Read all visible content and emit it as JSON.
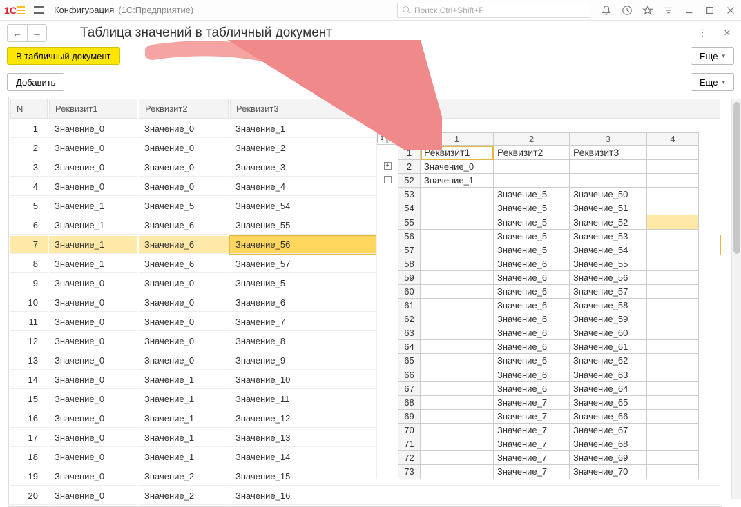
{
  "titlebar": {
    "app": "Конфигурация",
    "sub": "(1С:Предприятие)",
    "search_placeholder": "Поиск Ctrl+Shift+F"
  },
  "page": {
    "title": "Таблица значений в табличный документ",
    "btn_to_doc": "В табличный документ",
    "btn_more": "Еще",
    "btn_add": "Добавить"
  },
  "left": {
    "headers": {
      "n": "N",
      "r1": "Реквизит1",
      "r2": "Реквизит2",
      "r3": "Реквизит3"
    },
    "rows": [
      {
        "n": 1,
        "r1": "Значение_0",
        "r2": "Значение_0",
        "r3": "Значение_1"
      },
      {
        "n": 2,
        "r1": "Значение_0",
        "r2": "Значение_0",
        "r3": "Значение_2"
      },
      {
        "n": 3,
        "r1": "Значение_0",
        "r2": "Значение_0",
        "r3": "Значение_3"
      },
      {
        "n": 4,
        "r1": "Значение_0",
        "r2": "Значение_0",
        "r3": "Значение_4"
      },
      {
        "n": 5,
        "r1": "Значение_1",
        "r2": "Значение_5",
        "r3": "Значение_54"
      },
      {
        "n": 6,
        "r1": "Значение_1",
        "r2": "Значение_6",
        "r3": "Значение_55"
      },
      {
        "n": 7,
        "r1": "Значение_1",
        "r2": "Значение_6",
        "r3": "Значение_56",
        "sel": true
      },
      {
        "n": 8,
        "r1": "Значение_1",
        "r2": "Значение_6",
        "r3": "Значение_57"
      },
      {
        "n": 9,
        "r1": "Значение_0",
        "r2": "Значение_0",
        "r3": "Значение_5"
      },
      {
        "n": 10,
        "r1": "Значение_0",
        "r2": "Значение_0",
        "r3": "Значение_6"
      },
      {
        "n": 11,
        "r1": "Значение_0",
        "r2": "Значение_0",
        "r3": "Значение_7"
      },
      {
        "n": 12,
        "r1": "Значение_0",
        "r2": "Значение_0",
        "r3": "Значение_8"
      },
      {
        "n": 13,
        "r1": "Значение_0",
        "r2": "Значение_0",
        "r3": "Значение_9"
      },
      {
        "n": 14,
        "r1": "Значение_0",
        "r2": "Значение_1",
        "r3": "Значение_10"
      },
      {
        "n": 15,
        "r1": "Значение_0",
        "r2": "Значение_1",
        "r3": "Значение_11"
      },
      {
        "n": 16,
        "r1": "Значение_0",
        "r2": "Значение_1",
        "r3": "Значение_12"
      },
      {
        "n": 17,
        "r1": "Значение_0",
        "r2": "Значение_1",
        "r3": "Значение_13"
      },
      {
        "n": 18,
        "r1": "Значение_0",
        "r2": "Значение_1",
        "r3": "Значение_14"
      },
      {
        "n": 19,
        "r1": "Значение_0",
        "r2": "Значение_2",
        "r3": "Значение_15"
      },
      {
        "n": 20,
        "r1": "Значение_0",
        "r2": "Значение_2",
        "r3": "Значение_16"
      }
    ]
  },
  "sheet": {
    "col_headers": [
      "1",
      "2",
      "3",
      "4"
    ],
    "header_row": {
      "rh": "1",
      "c1": "Реквизит1",
      "c2": "Реквизит2",
      "c3": "Реквизит3"
    },
    "rows": [
      {
        "rh": "2",
        "c1": "Значение_0",
        "c2": "",
        "c3": ""
      },
      {
        "rh": "52",
        "c1": "Значение_1",
        "c2": "",
        "c3": ""
      },
      {
        "rh": "53",
        "c1": "",
        "c2": "Значение_5",
        "c3": "Значение_50"
      },
      {
        "rh": "54",
        "c1": "",
        "c2": "Значение_5",
        "c3": "Значение_51"
      },
      {
        "rh": "55",
        "c1": "",
        "c2": "Значение_5",
        "c3": "Значение_52",
        "sel4": true
      },
      {
        "rh": "56",
        "c1": "",
        "c2": "Значение_5",
        "c3": "Значение_53"
      },
      {
        "rh": "57",
        "c1": "",
        "c2": "Значение_5",
        "c3": "Значение_54"
      },
      {
        "rh": "58",
        "c1": "",
        "c2": "Значение_6",
        "c3": "Значение_55"
      },
      {
        "rh": "59",
        "c1": "",
        "c2": "Значение_6",
        "c3": "Значение_56"
      },
      {
        "rh": "60",
        "c1": "",
        "c2": "Значение_6",
        "c3": "Значение_57"
      },
      {
        "rh": "61",
        "c1": "",
        "c2": "Значение_6",
        "c3": "Значение_58"
      },
      {
        "rh": "62",
        "c1": "",
        "c2": "Значение_6",
        "c3": "Значение_59"
      },
      {
        "rh": "63",
        "c1": "",
        "c2": "Значение_6",
        "c3": "Значение_60"
      },
      {
        "rh": "64",
        "c1": "",
        "c2": "Значение_6",
        "c3": "Значение_61"
      },
      {
        "rh": "65",
        "c1": "",
        "c2": "Значение_6",
        "c3": "Значение_62"
      },
      {
        "rh": "66",
        "c1": "",
        "c2": "Значение_6",
        "c3": "Значение_63"
      },
      {
        "rh": "67",
        "c1": "",
        "c2": "Значение_6",
        "c3": "Значение_64"
      },
      {
        "rh": "68",
        "c1": "",
        "c2": "Значение_7",
        "c3": "Значение_65"
      },
      {
        "rh": "69",
        "c1": "",
        "c2": "Значение_7",
        "c3": "Значение_66"
      },
      {
        "rh": "70",
        "c1": "",
        "c2": "Значение_7",
        "c3": "Значение_67"
      },
      {
        "rh": "71",
        "c1": "",
        "c2": "Значение_7",
        "c3": "Значение_68"
      },
      {
        "rh": "72",
        "c1": "",
        "c2": "Значение_7",
        "c3": "Значение_69"
      },
      {
        "rh": "73",
        "c1": "",
        "c2": "Значение_7",
        "c3": "Значение_70"
      }
    ],
    "outline_levels": [
      "1",
      "2"
    ],
    "outline_boxes": [
      "+",
      "−"
    ]
  }
}
